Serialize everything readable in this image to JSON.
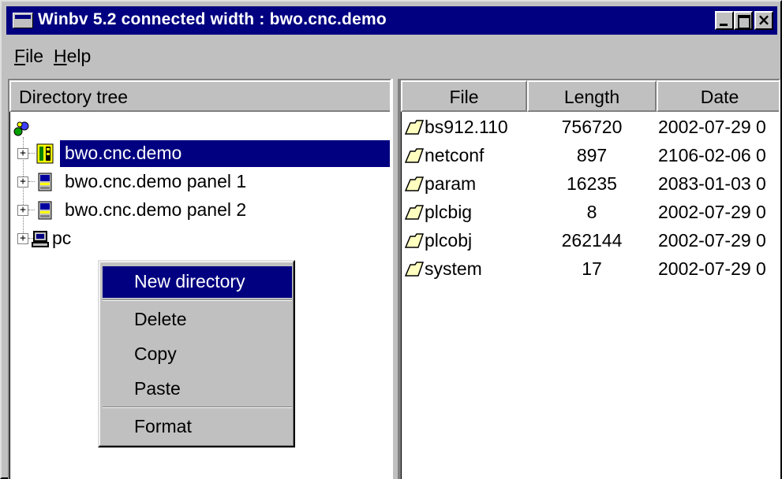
{
  "window": {
    "title": "Winbv 5.2 connected width : bwo.cnc.demo",
    "close_glyph": "×"
  },
  "menu": [
    {
      "label": "File",
      "mnemonic": "F",
      "rest": "ile"
    },
    {
      "label": "Help",
      "mnemonic": "H",
      "rest": "elp"
    }
  ],
  "tree": {
    "header": "Directory tree",
    "root_icon": "network-icon",
    "expander_glyph": "+",
    "items": [
      {
        "label": "bwo.cnc.demo",
        "icon": "cnc-controller-icon",
        "selected": true
      },
      {
        "label": "bwo.cnc.demo panel 1",
        "icon": "panel-icon",
        "selected": false
      },
      {
        "label": "bwo.cnc.demo panel 2",
        "icon": "panel-icon",
        "selected": false
      },
      {
        "label": "pc",
        "icon": "computer-icon",
        "selected": false
      }
    ]
  },
  "files": {
    "columns": [
      "File",
      "Length",
      "Date"
    ],
    "rows": [
      {
        "name": "bs912.110",
        "length": "756720",
        "date": "2002-07-29 0"
      },
      {
        "name": "netconf",
        "length": "897",
        "date": "2106-02-06 0"
      },
      {
        "name": "param",
        "length": "16235",
        "date": "2083-01-03 0"
      },
      {
        "name": "plcbig",
        "length": "8",
        "date": "2002-07-29 0"
      },
      {
        "name": "plcobj",
        "length": "262144",
        "date": "2002-07-29 0"
      },
      {
        "name": "system",
        "length": "17",
        "date": "2002-07-29 0"
      }
    ],
    "row_icon": "folder-icon"
  },
  "context_menu": {
    "items": [
      {
        "label": "New directory",
        "highlighted": true
      },
      {
        "label": "Delete",
        "highlighted": false
      },
      {
        "label": "Copy",
        "highlighted": false
      },
      {
        "label": "Paste",
        "highlighted": false
      },
      {
        "label": "Format",
        "highlighted": false
      }
    ]
  },
  "colors": {
    "titlebar": "#000080",
    "selection": "#000080",
    "face": "#c0c0c0"
  }
}
